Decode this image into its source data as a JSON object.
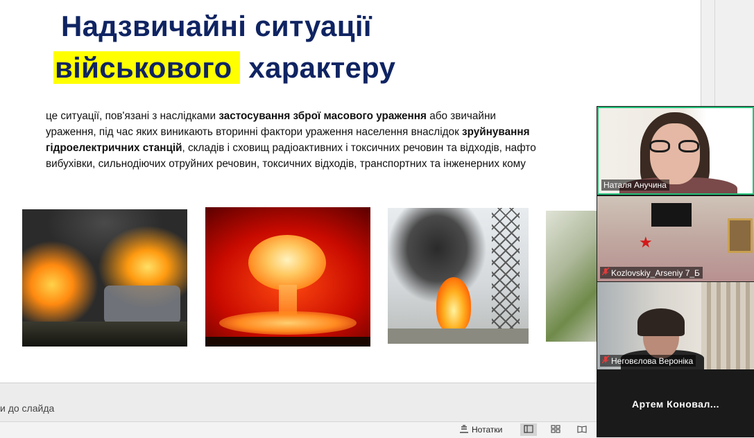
{
  "slide": {
    "title_line1": "Надзвичайні ситуації",
    "title_line2_highlight": "військового",
    "title_line2_rest": " характеру",
    "definition": {
      "p1": "це ситуації, пов'язані з наслідками ",
      "b1": "застосування зброї масового ураження",
      "p2": " або звичайни",
      "p3": "ураження, під час яких виникають вторинні фактори ураження населення внаслідок ",
      "b2": "зруйнування",
      "b3": "гідроелектричних станцій",
      "p4": ", складів і сховищ радіоактивних і токсичних речовин та відходів, нафто",
      "p5": "вибухівки, сильнодіючих отруйних речовин, токсичних відходів, транспортних та інженерних кому"
    }
  },
  "notes": {
    "placeholder": "и до слайда"
  },
  "status_bar": {
    "notes_label": "Нотатки",
    "notes_icon": "notes-icon",
    "view_normal_icon": "normal-view-icon",
    "view_sorter_icon": "slide-sorter-icon",
    "view_reading_icon": "reading-view-icon"
  },
  "zoom": {
    "active_speaker_color": "#24c27a",
    "participants": [
      {
        "name": "Наталя Анучина",
        "muted": false
      },
      {
        "name": "Kozlovskiy_Arseniy 7_Б",
        "muted": true
      },
      {
        "name": "Неговєлова Вероніка",
        "muted": true
      },
      {
        "name": "Артем  Коновал...",
        "muted": false
      }
    ]
  }
}
